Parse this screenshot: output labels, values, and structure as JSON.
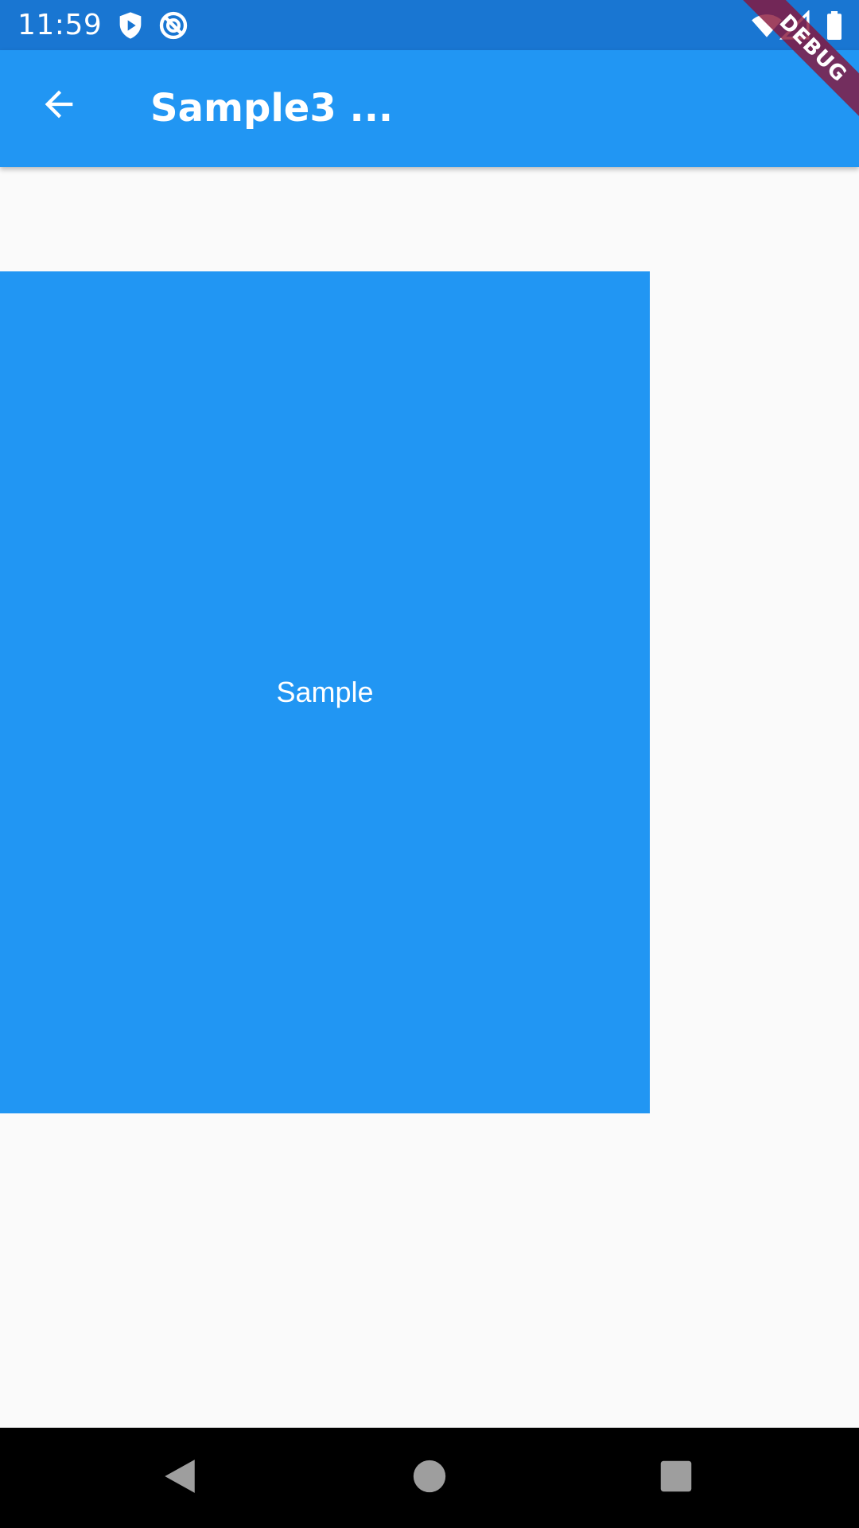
{
  "status_bar": {
    "time": "11:59",
    "color": "#1976d2",
    "icons": [
      "shield-play-icon",
      "no-sync-icon",
      "wifi-icon",
      "signal-icon",
      "battery-icon"
    ]
  },
  "app_bar": {
    "title": "Sample3 ...",
    "color": "#2196f3",
    "back_icon": "arrow-back-icon"
  },
  "debug_banner": {
    "label": "DEBUG"
  },
  "content": {
    "box_label": "Sample",
    "box_color": "#2196f3",
    "background": "#fafafa"
  },
  "nav_bar": {
    "buttons": [
      "back-triangle-icon",
      "home-circle-icon",
      "recents-square-icon"
    ]
  }
}
